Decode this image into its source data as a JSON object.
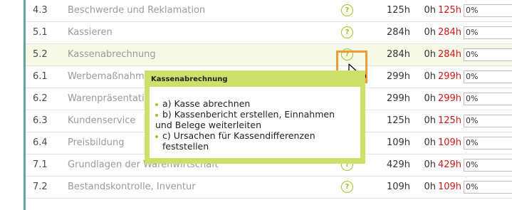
{
  "rows": [
    {
      "num": "4.3",
      "title": "Beschwerde und Reklamation",
      "help": "?",
      "hours": "125h",
      "done": "0h",
      "remaining": "125h",
      "progress_label": "0%",
      "progress": 0
    },
    {
      "num": "5.1",
      "title": "Kassieren",
      "help": "?",
      "hours": "284h",
      "done": "0h",
      "remaining": "284h",
      "progress_label": "0%",
      "progress": 0
    },
    {
      "num": "5.2",
      "title": "Kassenabrechnung",
      "help": "?",
      "hours": "284h",
      "done": "0h",
      "remaining": "284h",
      "progress_label": "0%",
      "progress": 0
    },
    {
      "num": "6.1",
      "title": "Werbemaßnahme",
      "help": "?",
      "hours": "299h",
      "done": "0h",
      "remaining": "299h",
      "progress_label": "0%",
      "progress": 0
    },
    {
      "num": "6.2",
      "title": "Warenpräsentati",
      "help": "?",
      "hours": "299h",
      "done": "0h",
      "remaining": "299h",
      "progress_label": "0%",
      "progress": 0
    },
    {
      "num": "6.3",
      "title": "Kundenservice",
      "help": "?",
      "hours": "125h",
      "done": "0h",
      "remaining": "125h",
      "progress_label": "0%",
      "progress": 0
    },
    {
      "num": "6.4",
      "title": "Preisbildung",
      "help": "?",
      "hours": "109h",
      "done": "0h",
      "remaining": "109h",
      "progress_label": "0%",
      "progress": 0
    },
    {
      "num": "7.1",
      "title": "Grundlagen der Warenwirtschaft",
      "help": "?",
      "hours": "429h",
      "done": "0h",
      "remaining": "429h",
      "progress_label": "0%",
      "progress": 0
    },
    {
      "num": "7.2",
      "title": "Bestandskontrolle, Inventur",
      "help": "?",
      "hours": "109h",
      "done": "0h",
      "remaining": "109h",
      "progress_label": "0%",
      "progress": 0
    }
  ],
  "tooltip": {
    "title": "Kassenabrechnung",
    "items": [
      "a) Kasse abrechnen",
      "b) Kassenbericht erstellen, Einnahmen und Belege weiterleiten",
      "c) Ursachen für Kassendifferenzen feststellen"
    ]
  },
  "colors": {
    "accent": "#a6bf2a",
    "remaining_red": "#d21818",
    "focus_orange": "#f09a3a",
    "tooltip_bg": "#cde06a",
    "left_rule": "#5aa8a0"
  },
  "icons": {
    "help": "question-circle-icon",
    "cursor": "pointer-help-cursor-icon"
  }
}
